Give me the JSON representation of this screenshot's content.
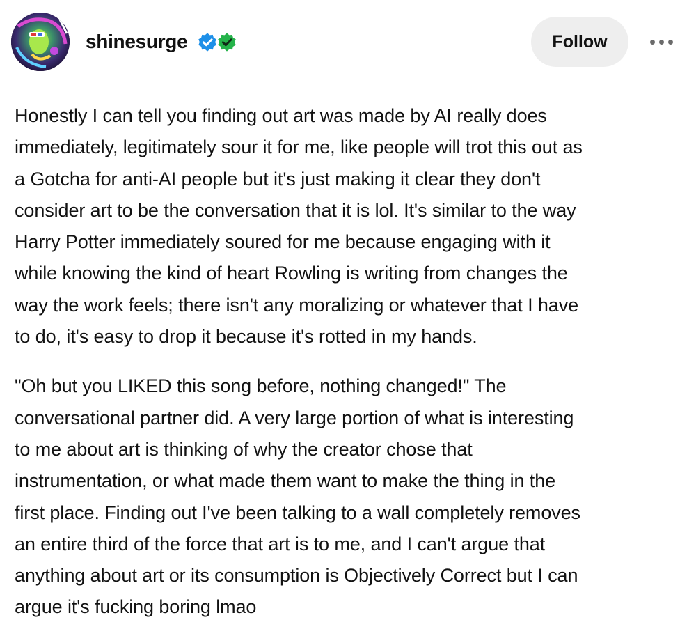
{
  "post": {
    "author": {
      "username": "shinesurge",
      "badges": [
        "verified-blue-icon",
        "verified-green-icon"
      ]
    },
    "actions": {
      "follow_label": "Follow",
      "more_icon": "more-horizontal-icon"
    },
    "paragraphs": [
      "Honestly I can tell you finding out art was made by AI really does\nimmediately, legitimately sour it for me, like people will trot this out as\na Gotcha for anti-AI people but it's just making it clear they don't\nconsider art to be the conversation that it is lol. It's similar to the way\nHarry Potter immediately soured for me because engaging with it\nwhile knowing the kind of heart Rowling is writing from changes the\nway the work feels; there isn't any moralizing or whatever that I have\nto do, it's easy to drop it because it's rotted in my hands.",
      "\"Oh but you LIKED this song before, nothing changed!\" The\nconversational partner did. A very large portion of what is interesting\nto me about art is thinking of why the creator chose that\ninstrumentation, or what made them want to make the thing in the\nfirst place. Finding out I've been talking to a wall completely removes\nan entire third of the force that art is to me, and I can't argue that\nanything about art or its consumption is Objectively Correct but I can\nargue it's fucking boring lmao"
    ]
  },
  "colors": {
    "text": "#121212",
    "follow_bg": "#eeeeee",
    "verified_blue": "#1d8fe8",
    "verified_green": "#25b34a"
  }
}
